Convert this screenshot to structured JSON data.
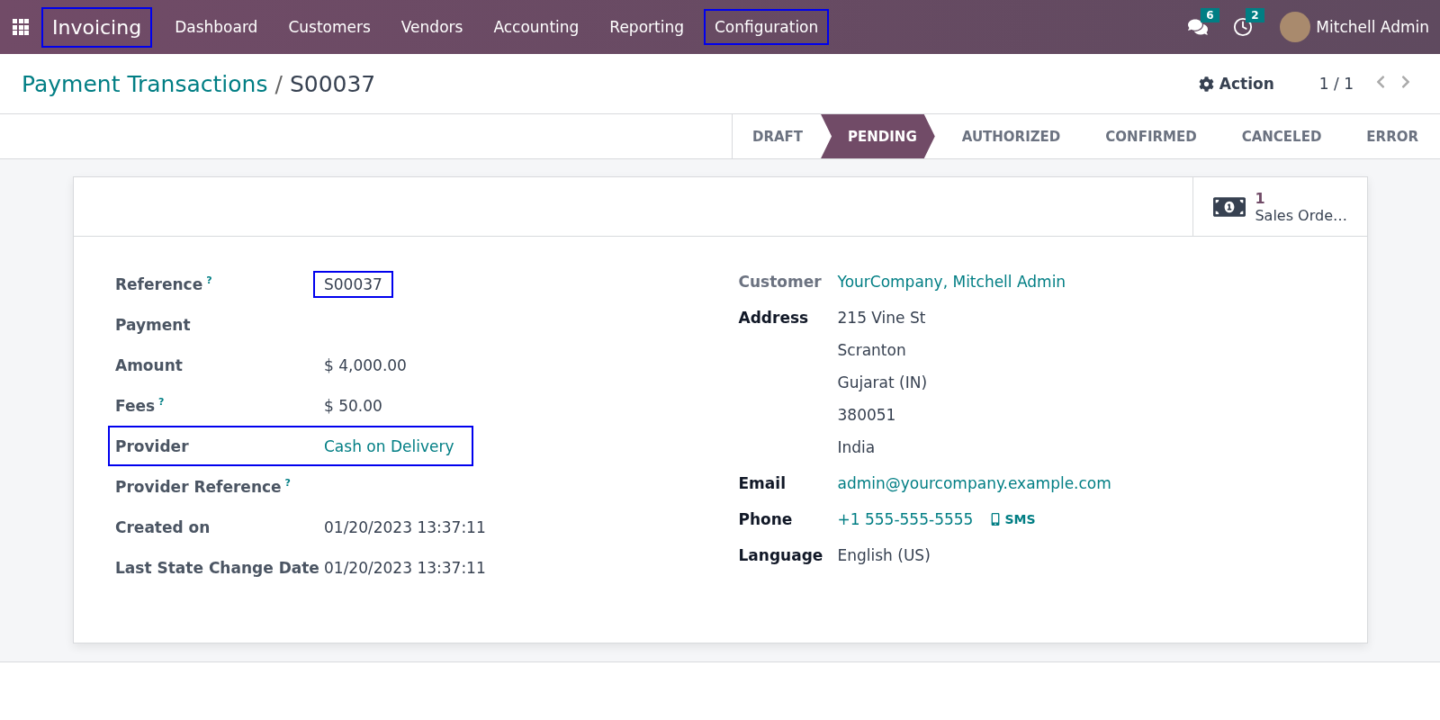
{
  "navbar": {
    "app": {
      "label": "Invoicing",
      "highlighted": true
    },
    "menu": [
      {
        "label": "Dashboard",
        "highlighted": false
      },
      {
        "label": "Customers",
        "highlighted": false
      },
      {
        "label": "Vendors",
        "highlighted": false
      },
      {
        "label": "Accounting",
        "highlighted": false
      },
      {
        "label": "Reporting",
        "highlighted": false
      },
      {
        "label": "Configuration",
        "highlighted": true
      }
    ],
    "messages_count": "6",
    "activities_count": "2",
    "user": "Mitchell Admin"
  },
  "breadcrumb": {
    "parent": "Payment Transactions",
    "separator": "/",
    "current": "S00037"
  },
  "control_panel": {
    "action": "Action",
    "pager": "1 / 1"
  },
  "status_steps": [
    {
      "label": "DRAFT",
      "selected": false
    },
    {
      "label": "PENDING",
      "selected": true
    },
    {
      "label": "AUTHORIZED",
      "selected": false
    },
    {
      "label": "CONFIRMED",
      "selected": false
    },
    {
      "label": "CANCELED",
      "selected": false
    },
    {
      "label": "ERROR",
      "selected": false
    }
  ],
  "smart_button": {
    "count": "1",
    "label": "Sales Orde…"
  },
  "left_fields": [
    {
      "label": "Reference",
      "help": "?",
      "kind": "text",
      "value": "S00037",
      "value_highlighted": true,
      "row_highlighted": false
    },
    {
      "label": "Payment",
      "kind": "empty",
      "value_highlighted": false,
      "row_highlighted": false
    },
    {
      "label": "Amount",
      "kind": "text",
      "value": "$ 4,000.00",
      "value_highlighted": false,
      "row_highlighted": false
    },
    {
      "label": "Fees",
      "help": "?",
      "kind": "text",
      "value": "$ 50.00",
      "value_highlighted": false,
      "row_highlighted": false
    },
    {
      "label": "Provider",
      "kind": "link",
      "value": "Cash on Delivery",
      "value_highlighted": false,
      "row_highlighted": true
    },
    {
      "label": "Provider Reference",
      "help": "?",
      "kind": "empty",
      "value_highlighted": false,
      "row_highlighted": false
    },
    {
      "label": "Created on",
      "kind": "text",
      "value": "01/20/2023 13:37:11",
      "value_highlighted": false,
      "row_highlighted": false
    },
    {
      "label": "Last State Change Date",
      "kind": "text",
      "value": "01/20/2023 13:37:11",
      "value_highlighted": false,
      "row_highlighted": false
    }
  ],
  "right_fields": [
    {
      "label": "Customer",
      "strong": false,
      "kind": "link",
      "value": "YourCompany, Mitchell Admin"
    },
    {
      "label": "Address",
      "strong": true,
      "kind": "lines",
      "lines": [
        "215 Vine St",
        "Scranton",
        "Gujarat (IN)",
        "380051",
        "India"
      ]
    },
    {
      "label": "Email",
      "strong": true,
      "kind": "link",
      "value": "admin@yourcompany.example.com"
    },
    {
      "label": "Phone",
      "strong": true,
      "kind": "phone",
      "value": "+1 555-555-5555",
      "action": "SMS"
    },
    {
      "label": "Language",
      "strong": true,
      "kind": "text",
      "value": "English (US)"
    }
  ]
}
